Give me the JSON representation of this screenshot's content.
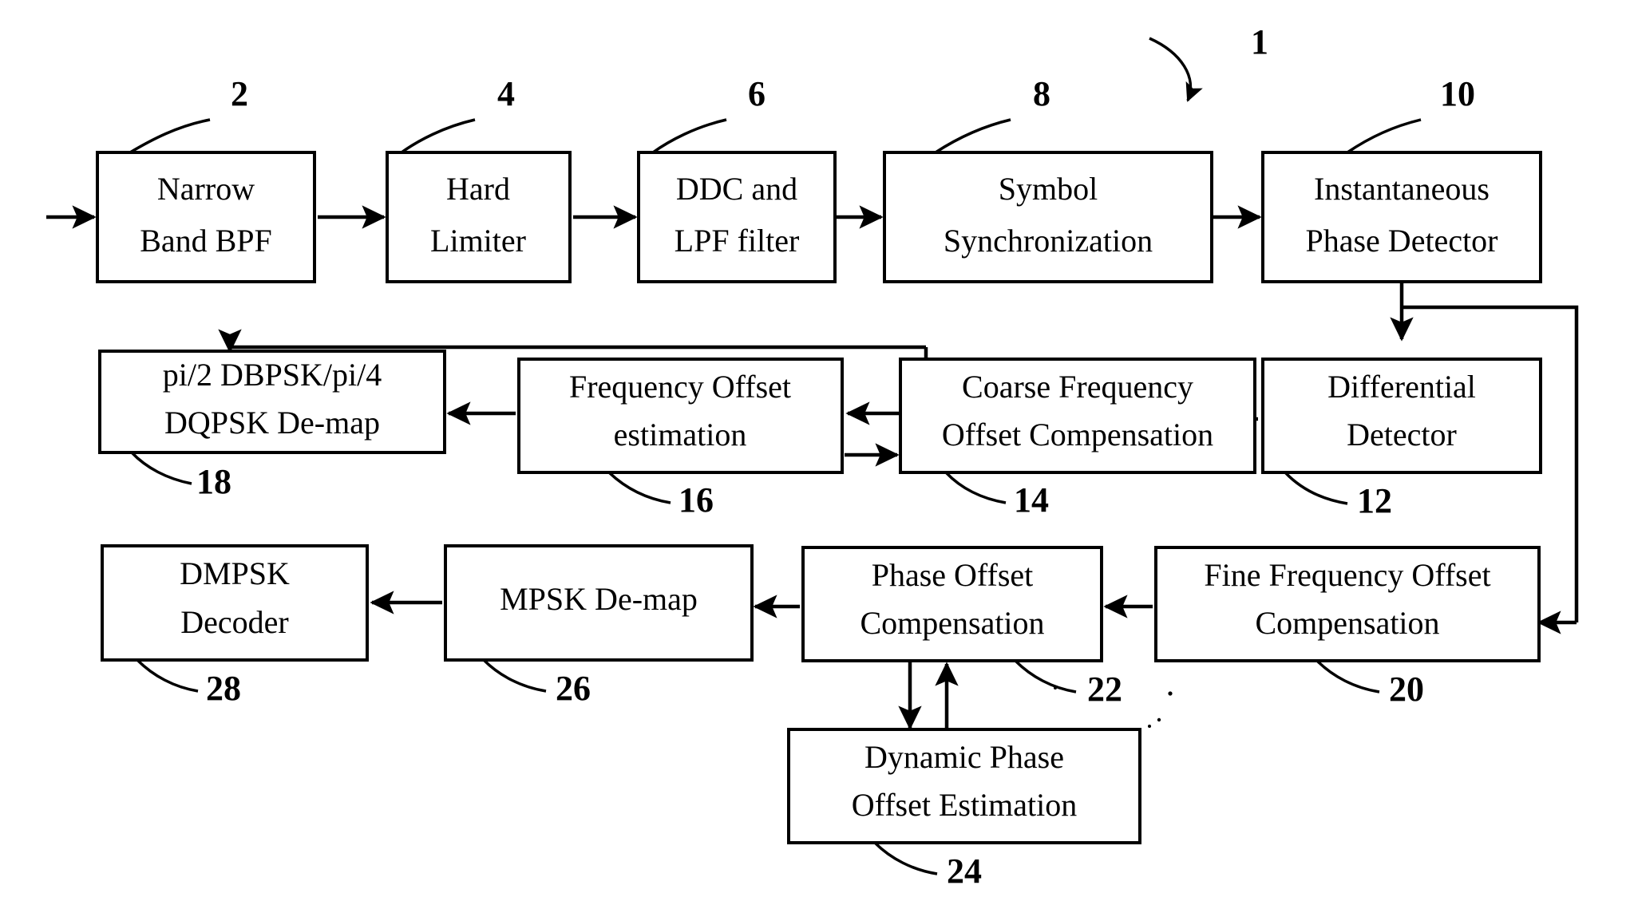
{
  "figure": {
    "title_ref": "1",
    "blocks": [
      {
        "id": "b2",
        "ref": "2",
        "line1": "Narrow",
        "line2": "Band BPF"
      },
      {
        "id": "b4",
        "ref": "4",
        "line1": "Hard",
        "line2": "Limiter"
      },
      {
        "id": "b6",
        "ref": "6",
        "line1": "DDC and",
        "line2": "LPF filter"
      },
      {
        "id": "b8",
        "ref": "8",
        "line1": "Symbol",
        "line2": "Synchronization"
      },
      {
        "id": "b10",
        "ref": "10",
        "line1": "Instantaneous",
        "line2": "Phase Detector"
      },
      {
        "id": "b12",
        "ref": "12",
        "line1": "Differential",
        "line2": "Detector"
      },
      {
        "id": "b14",
        "ref": "14",
        "line1": "Coarse Frequency",
        "line2": "Offset Compensation"
      },
      {
        "id": "b16",
        "ref": "16",
        "line1": "Frequency Offset",
        "line2": "estimation"
      },
      {
        "id": "b18",
        "ref": "18",
        "line1": "pi/2 DBPSK/pi/4",
        "line2": "DQPSK De-map"
      },
      {
        "id": "b20",
        "ref": "20",
        "line1": "Fine Frequency Offset",
        "line2": "Compensation"
      },
      {
        "id": "b22",
        "ref": "22",
        "line1": "Phase Offset",
        "line2": "Compensation"
      },
      {
        "id": "b24",
        "ref": "24",
        "line1": "Dynamic Phase",
        "line2": "Offset Estimation"
      },
      {
        "id": "b26",
        "ref": "26",
        "line1": "MPSK  De-map",
        "line2": ""
      },
      {
        "id": "b28",
        "ref": "28",
        "line1": "DMPSK",
        "line2": "Decoder"
      }
    ],
    "colors": {
      "ink": "#000000",
      "paper": "#ffffff"
    }
  }
}
